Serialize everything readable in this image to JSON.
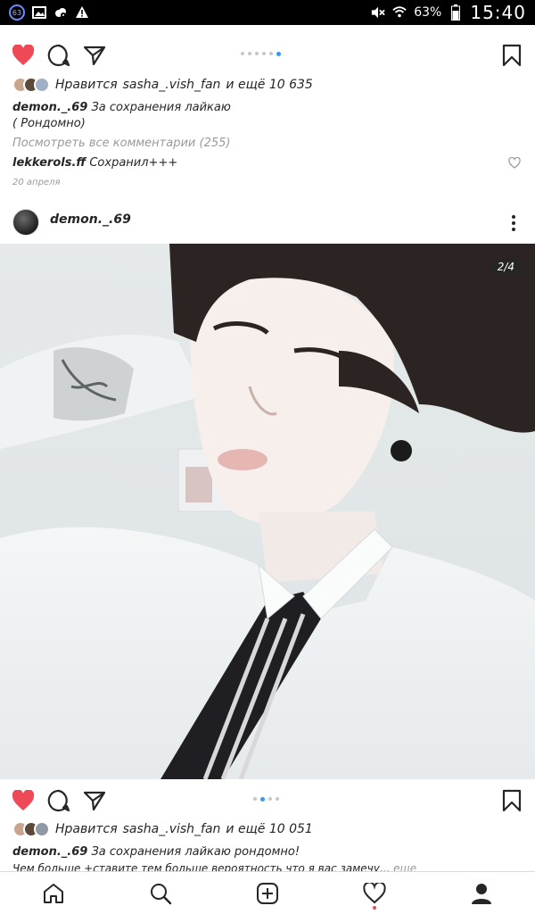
{
  "status_bar": {
    "notification_count": "63",
    "battery": "63%",
    "time": "15:40"
  },
  "post_top": {
    "likes_prefix": "Нравится",
    "likes_user": "sasha_.vish_fan",
    "likes_suffix": "и ещё 10 635",
    "caption_user": "demon._.69",
    "caption_text": "За сохранения лайкаю",
    "caption_line2": "( Рондомно)",
    "view_comments": "Посмотреть все комментарии (255)",
    "comment_user": "lekkerols.ff",
    "comment_text": "Сохранил+++",
    "date": "20 апреля"
  },
  "post_main": {
    "username": "demon._.69",
    "counter": "2/4",
    "likes_prefix": "Нравится",
    "likes_user": "sasha_.vish_fan",
    "likes_suffix": "и ещё 10 051",
    "caption_user": "demon._.69",
    "caption_text": "За сохранения лайкаю рондомно!",
    "caption_line2": "Чем больше +ставите тем больше вероятность что я вас замечу...",
    "more": "еще"
  },
  "icons": {
    "like": "heart-filled-icon",
    "comment": "comment-icon",
    "share": "share-icon",
    "save": "bookmark-icon",
    "more": "more-vertical-icon",
    "nav": [
      "home-icon",
      "search-icon",
      "add-icon",
      "activity-icon",
      "profile-icon"
    ]
  },
  "colors": {
    "like_red": "#ed4956",
    "dot_active": "#3897f0",
    "text": "#262626",
    "muted": "#999999"
  }
}
